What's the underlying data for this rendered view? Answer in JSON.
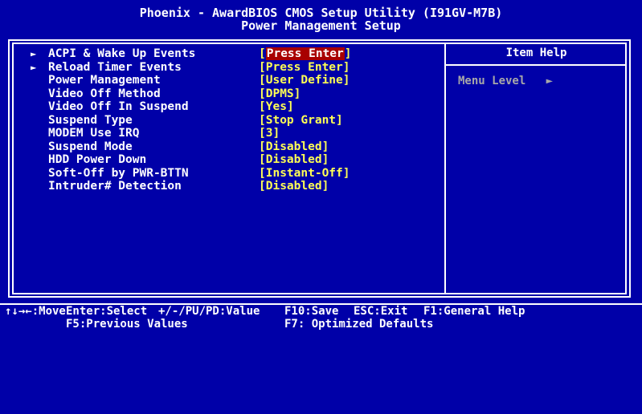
{
  "header": {
    "title": "Phoenix - AwardBIOS CMOS Setup Utility (I91GV-M7B)",
    "subtitle": "Power Management Setup"
  },
  "menu": {
    "items": [
      {
        "label": "ACPI & Wake Up Events",
        "value": "Press Enter",
        "submenu": true,
        "selected": true
      },
      {
        "label": "Reload Timer Events",
        "value": "Press Enter",
        "submenu": true,
        "selected": false
      },
      {
        "label": "Power Management",
        "value": "User Define",
        "submenu": false,
        "selected": false
      },
      {
        "label": "Video Off Method",
        "value": "DPMS",
        "submenu": false,
        "selected": false
      },
      {
        "label": "Video Off In Suspend",
        "value": "Yes",
        "submenu": false,
        "selected": false
      },
      {
        "label": "Suspend Type",
        "value": "Stop Grant",
        "submenu": false,
        "selected": false
      },
      {
        "label": "MODEM Use IRQ",
        "value": "3",
        "submenu": false,
        "selected": false
      },
      {
        "label": "Suspend Mode",
        "value": "Disabled",
        "submenu": false,
        "selected": false
      },
      {
        "label": "HDD Power Down",
        "value": "Disabled",
        "submenu": false,
        "selected": false
      },
      {
        "label": "Soft-Off by PWR-BTTN",
        "value": "Instant-Off",
        "submenu": false,
        "selected": false
      },
      {
        "label": "Intruder# Detection",
        "value": "Disabled",
        "submenu": false,
        "selected": false
      }
    ]
  },
  "help": {
    "title": "Item Help",
    "menu_level_label": "Menu Level",
    "menu_level_arrow": "►"
  },
  "footer": {
    "move": "↑↓→←:Move",
    "select": "Enter:Select",
    "value": "+/-/PU/PD:Value",
    "save": "F10:Save",
    "exit": "ESC:Exit",
    "help": "F1:General Help",
    "previous": "F5:Previous Values",
    "optimized": "F7: Optimized Defaults"
  },
  "colors": {
    "background": "#0000a8",
    "value_text": "#ffff54",
    "highlight": "#a80000",
    "dim_text": "#a8a8a8"
  }
}
